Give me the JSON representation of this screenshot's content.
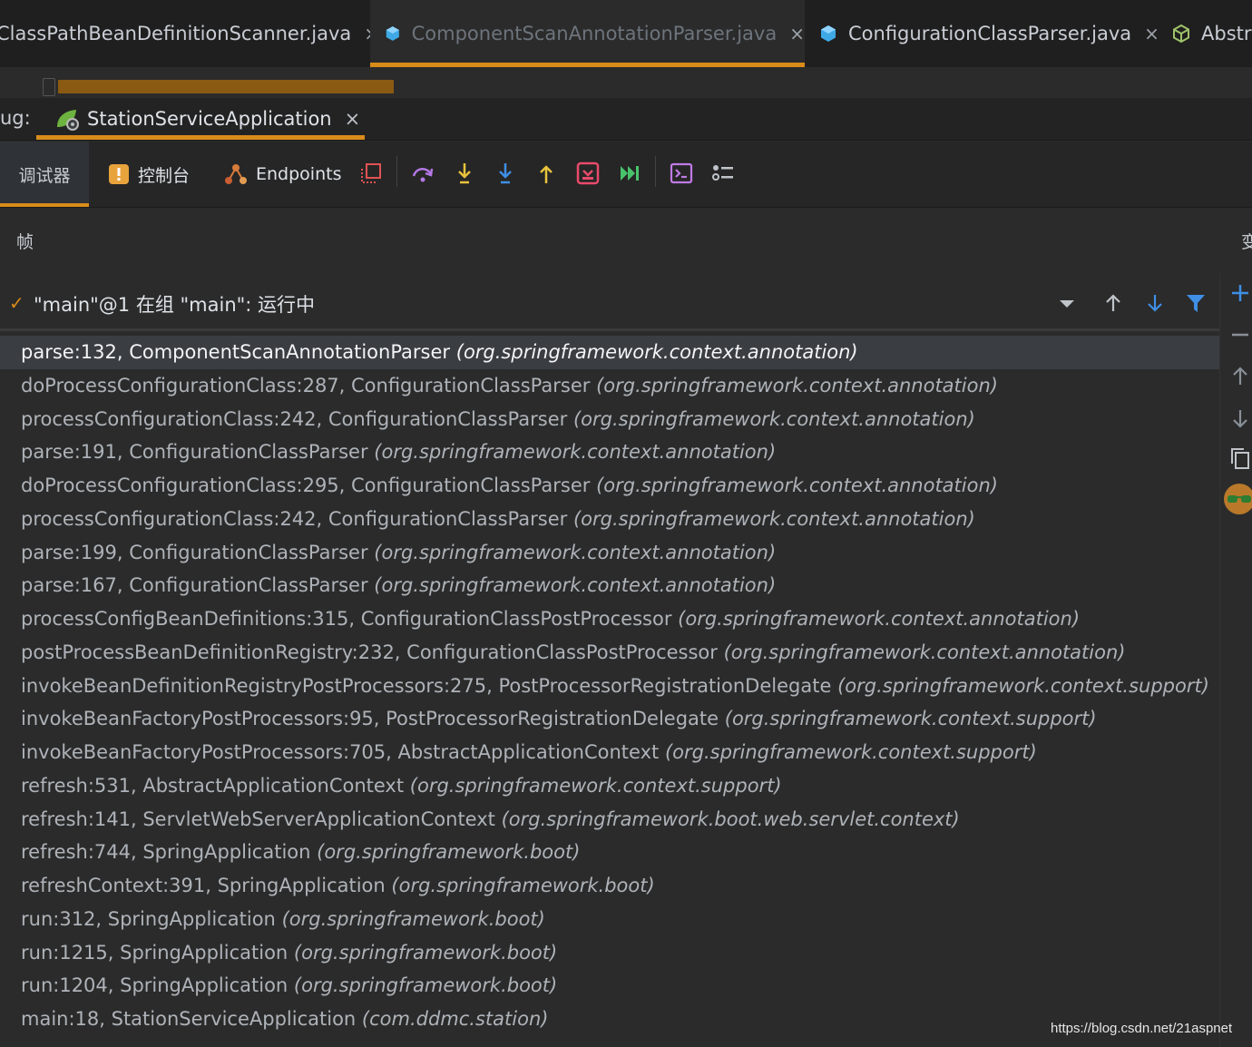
{
  "editor_tabs": [
    {
      "label": "ClassPathBeanDefinitionScanner.java",
      "close": "×",
      "active": false
    },
    {
      "label": "ComponentScanAnnotationParser.java",
      "close": "×",
      "active": true
    },
    {
      "label": "ConfigurationClassParser.java",
      "close": "×",
      "active": false
    },
    {
      "label": "Abstr",
      "close": "",
      "active": false
    }
  ],
  "debug": {
    "label": "ug:",
    "session_tab": "StationServiceApplication",
    "session_close": "×"
  },
  "toolbar": {
    "tab_debugger": "调试器",
    "tab_console": "控制台",
    "tab_endpoints": "Endpoints",
    "icons": [
      "frames-layout-icon",
      "step-over-icon",
      "step-into-icon",
      "force-step-into-icon",
      "step-out-icon",
      "run-to-cursor-icon",
      "resume-icon",
      "evaluate-icon",
      "trace-icon"
    ]
  },
  "frames_panel": {
    "label": "帧",
    "vars_label": "变",
    "thread": {
      "check": "✓",
      "text": "\"main\"@1 在组 \"main\": 运行中"
    }
  },
  "frames": [
    {
      "method": "parse:132, ComponentScanAnnotationParser",
      "pkg": "(org.springframework.context.annotation)",
      "selected": true
    },
    {
      "method": "doProcessConfigurationClass:287, ConfigurationClassParser",
      "pkg": "(org.springframework.context.annotation)"
    },
    {
      "method": "processConfigurationClass:242, ConfigurationClassParser",
      "pkg": "(org.springframework.context.annotation)"
    },
    {
      "method": "parse:191, ConfigurationClassParser",
      "pkg": "(org.springframework.context.annotation)"
    },
    {
      "method": "doProcessConfigurationClass:295, ConfigurationClassParser",
      "pkg": "(org.springframework.context.annotation)"
    },
    {
      "method": "processConfigurationClass:242, ConfigurationClassParser",
      "pkg": "(org.springframework.context.annotation)"
    },
    {
      "method": "parse:199, ConfigurationClassParser",
      "pkg": "(org.springframework.context.annotation)"
    },
    {
      "method": "parse:167, ConfigurationClassParser",
      "pkg": "(org.springframework.context.annotation)"
    },
    {
      "method": "processConfigBeanDefinitions:315, ConfigurationClassPostProcessor",
      "pkg": "(org.springframework.context.annotation)"
    },
    {
      "method": "postProcessBeanDefinitionRegistry:232, ConfigurationClassPostProcessor",
      "pkg": "(org.springframework.context.annotation)"
    },
    {
      "method": "invokeBeanDefinitionRegistryPostProcessors:275, PostProcessorRegistrationDelegate",
      "pkg": "(org.springframework.context.support)"
    },
    {
      "method": "invokeBeanFactoryPostProcessors:95, PostProcessorRegistrationDelegate",
      "pkg": "(org.springframework.context.support)"
    },
    {
      "method": "invokeBeanFactoryPostProcessors:705, AbstractApplicationContext",
      "pkg": "(org.springframework.context.support)"
    },
    {
      "method": "refresh:531, AbstractApplicationContext",
      "pkg": "(org.springframework.context.support)"
    },
    {
      "method": "refresh:141, ServletWebServerApplicationContext",
      "pkg": "(org.springframework.boot.web.servlet.context)"
    },
    {
      "method": "refresh:744, SpringApplication",
      "pkg": "(org.springframework.boot)"
    },
    {
      "method": "refreshContext:391, SpringApplication",
      "pkg": "(org.springframework.boot)"
    },
    {
      "method": "run:312, SpringApplication",
      "pkg": "(org.springframework.boot)"
    },
    {
      "method": "run:1215, SpringApplication",
      "pkg": "(org.springframework.boot)"
    },
    {
      "method": "run:1204, SpringApplication",
      "pkg": "(org.springframework.boot)"
    },
    {
      "method": "main:18, StationServiceApplication",
      "pkg": "(com.ddmc.station)"
    }
  ],
  "watermark": "https://blog.csdn.net/21aspnet",
  "colors": {
    "accent": "#d98c1a",
    "background": "#2b2b2b",
    "selected_row": "#3a3d41"
  }
}
